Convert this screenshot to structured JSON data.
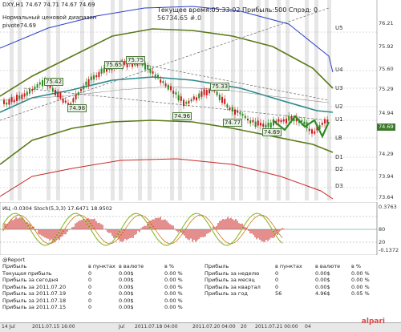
{
  "header": {
    "symbol_line": "DXY,H1  74.67 74.71 74.67 74.69",
    "range_label": "Нормальный ценовой диапазон",
    "pivot_label": "pivote74.69",
    "time_label": "Текущее время:05:33:02 Прибыль:500 Спрэд: 0",
    "code_label": "56734.65    #.0"
  },
  "chart_labels": [
    "75.42",
    "74.98",
    "75.65",
    "75.75",
    "75.33",
    "74.96",
    "74.77",
    "74.69"
  ],
  "level_labels": [
    "U5",
    "U4",
    "U3",
    "U2",
    "U1",
    "LB",
    "D1",
    "D2",
    "D3"
  ],
  "price_axis": [
    "76.21",
    "75.92",
    "75.60",
    "75.29",
    "74.94",
    "74.69",
    "74.29",
    "73.94",
    "73.64"
  ],
  "indicator": {
    "label": "ИЦ -0.0304  Stoch(5,3,3) 17.6471 18.9502",
    "axis": [
      "0.3763",
      "80",
      "20",
      "-0.1372"
    ]
  },
  "report": {
    "title": "@Report",
    "col_headers": [
      "в пунктах",
      "в валюте",
      "в %"
    ],
    "left_rows": [
      {
        "label": "Прибыль",
        "p": "в пунктах",
        "v": "в валюте",
        "pct": "в %"
      },
      {
        "label": "Текущая прибыль",
        "p": "0",
        "v": "0.00$",
        "pct": "0.00 %"
      },
      {
        "label": "Прибыль за сегодня",
        "p": "0",
        "v": "0.00$",
        "pct": "0.00 %"
      },
      {
        "label": "Прибыль за 2011.07.20",
        "p": "0",
        "v": "0.00$",
        "pct": "0.00 %"
      },
      {
        "label": "Прибыль за 2011.07.19",
        "p": "0",
        "v": "0.00$",
        "pct": "0.00 %"
      },
      {
        "label": "Прибыль за 2011.07.18",
        "p": "0",
        "v": "0.00$",
        "pct": "0.00 %"
      },
      {
        "label": "Прибыль за 2011.07.15",
        "p": "0",
        "v": "0.00$",
        "pct": "0.00 %"
      }
    ],
    "right_rows": [
      {
        "label": "Прибыль",
        "p": "в пунктах",
        "v": "в валюте",
        "pct": "в %"
      },
      {
        "label": "Прибыль за неделю",
        "p": "0",
        "v": "0.00$",
        "pct": "0.00 %"
      },
      {
        "label": "Прибыль за месяц",
        "p": "0",
        "v": "0.00$",
        "pct": "0.00 %"
      },
      {
        "label": "Прибыль за квартал",
        "p": "0",
        "v": "0.00$",
        "pct": "0.00 %"
      },
      {
        "label": "Прибыль за год",
        "p": "56",
        "v": "4.96$",
        "pct": "0.05 %"
      }
    ]
  },
  "time_axis": [
    "14 Jul",
    "2011.07.15 16:00",
    "Jul",
    "2011.07.18 04:00",
    "2011.07.20 04:00",
    "20",
    "2011.07.21 00:00",
    "04"
  ],
  "brand": "alpari",
  "colors": {
    "bull": "#2e8b22",
    "bear": "#c81e1e",
    "teal": "#2a8a8a",
    "olive": "#6a8a1a"
  }
}
